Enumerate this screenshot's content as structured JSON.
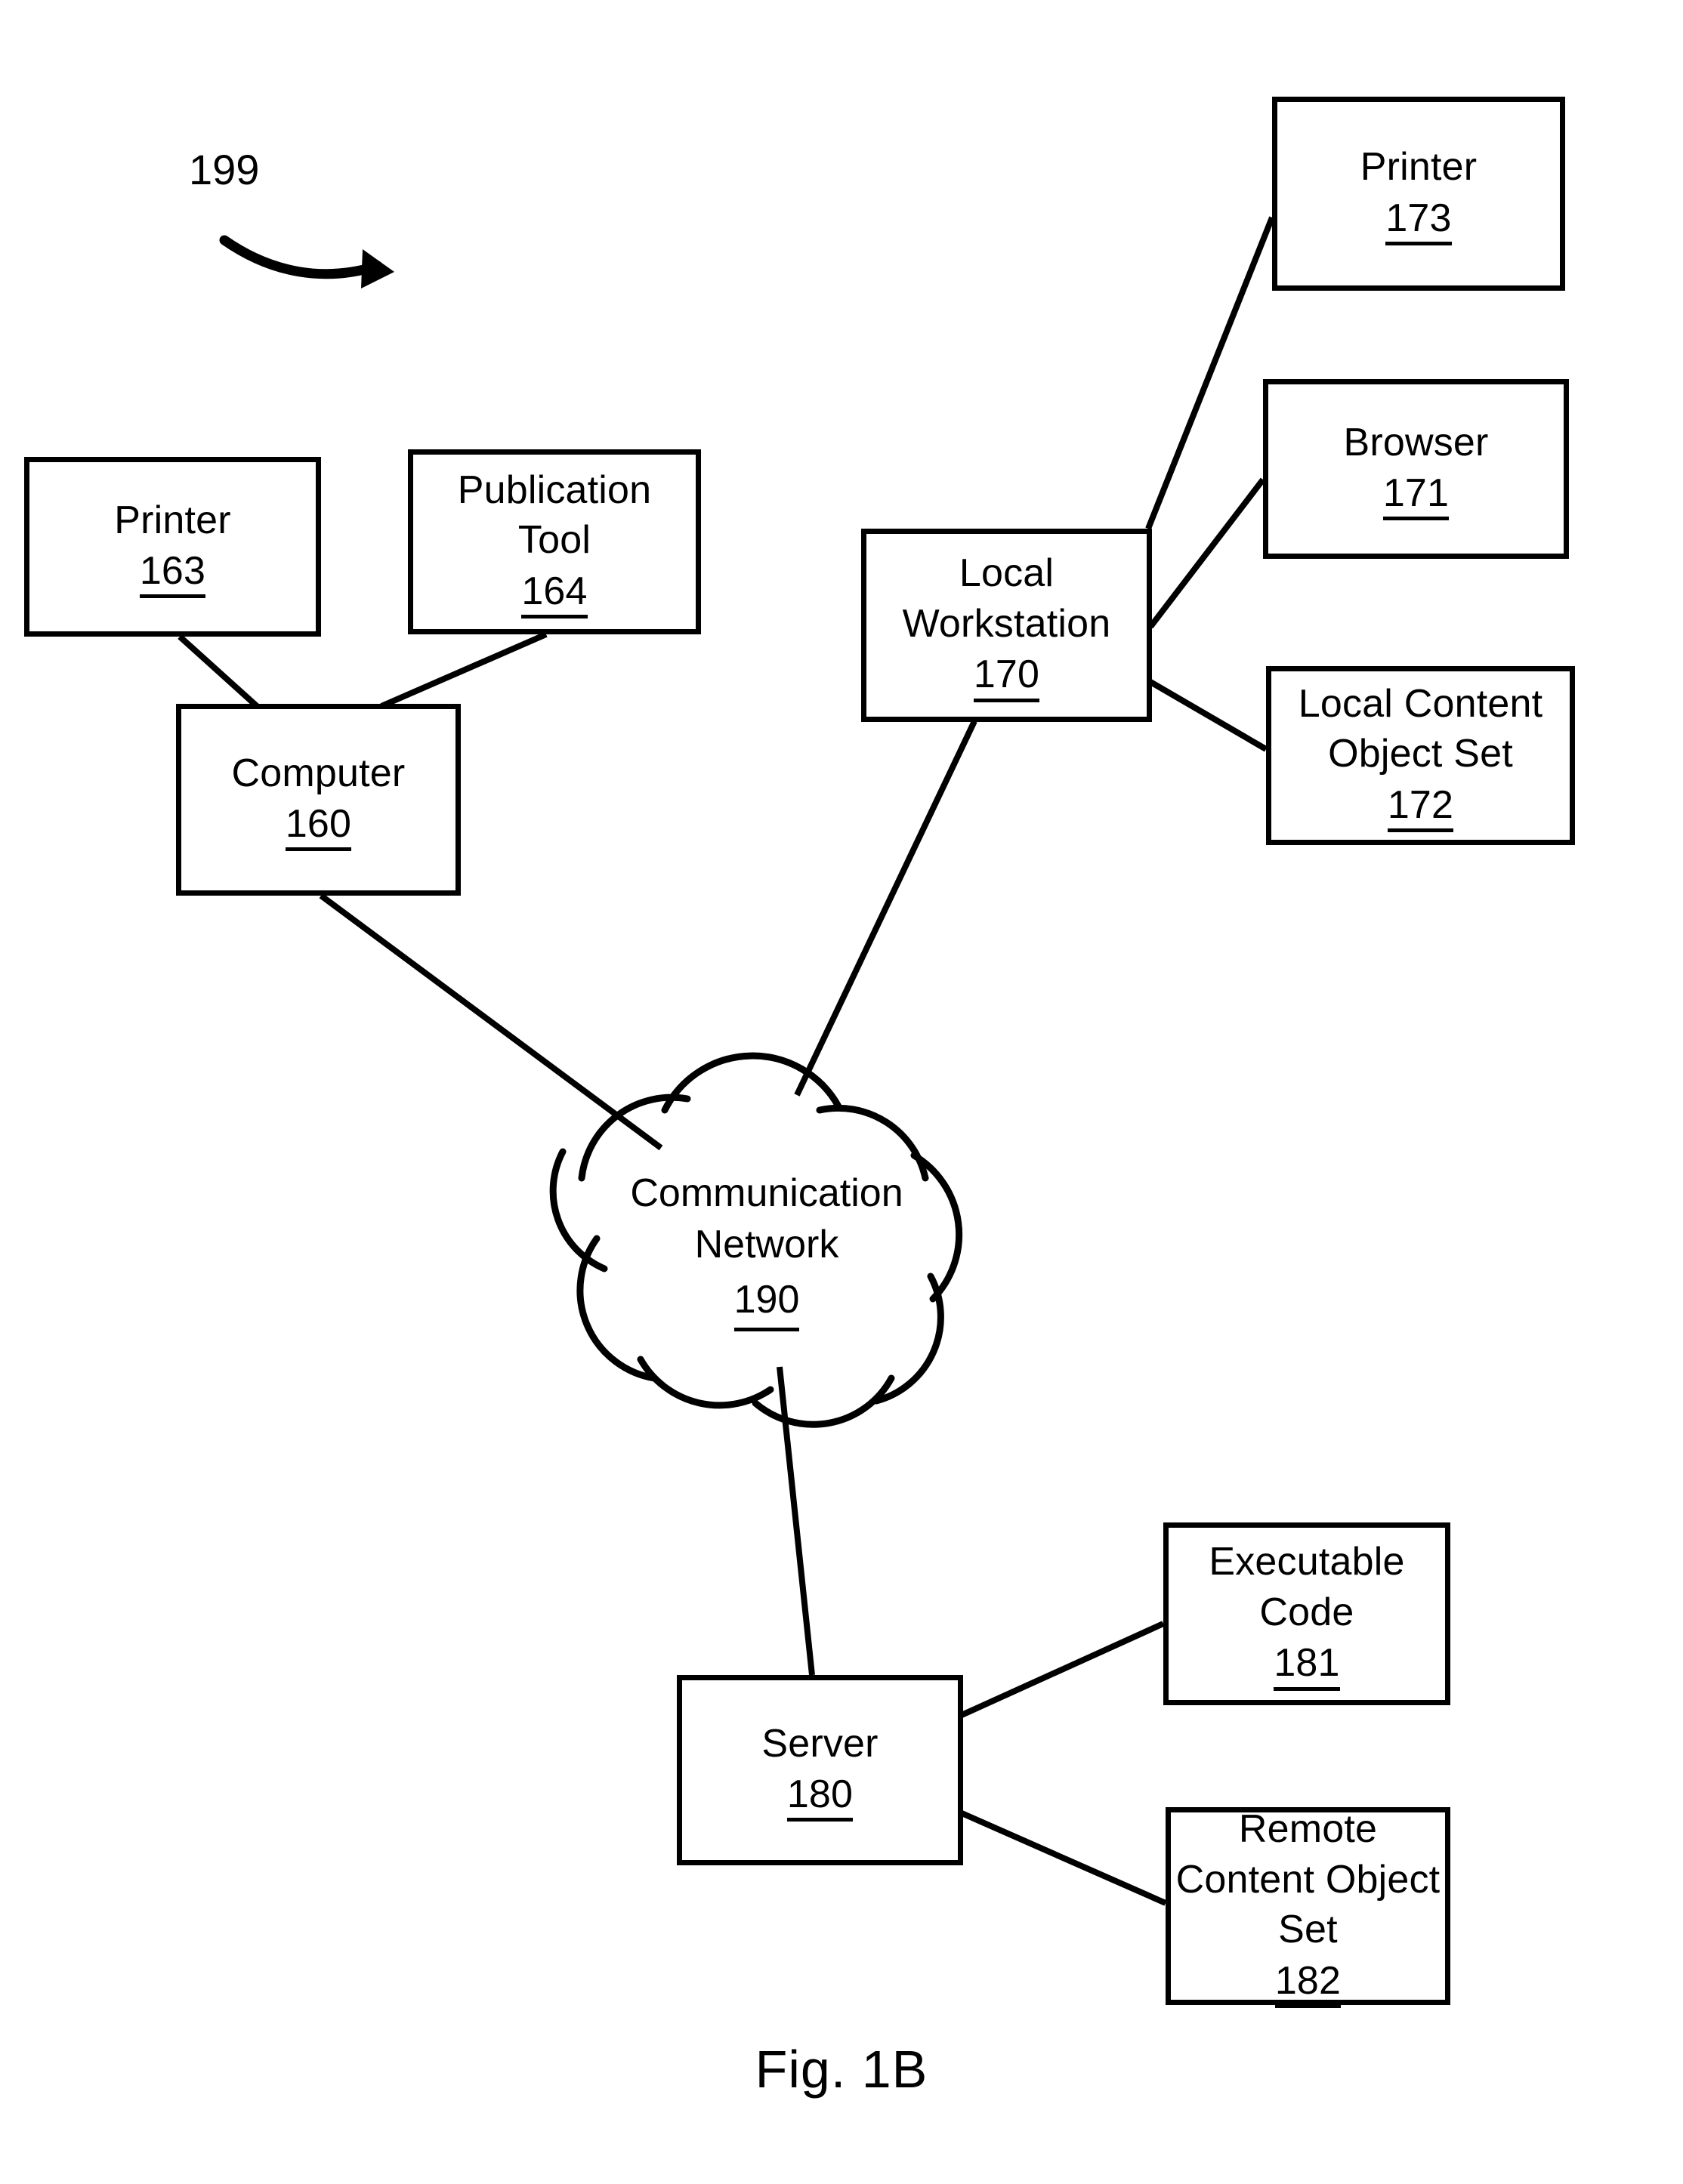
{
  "figure": {
    "caption": "Fig. 1B",
    "system_reference": "199"
  },
  "nodes": {
    "printer_173": {
      "label": "Printer",
      "ref": "173"
    },
    "browser_171": {
      "label": "Browser",
      "ref": "171"
    },
    "local_content_object_set_172": {
      "label": "Local Content\nObject Set",
      "ref": "172"
    },
    "local_workstation_170": {
      "label": "Local\nWorkstation",
      "ref": "170"
    },
    "printer_163": {
      "label": "Printer",
      "ref": "163"
    },
    "publication_tool_164": {
      "label": "Publication\nTool",
      "ref": "164"
    },
    "computer_160": {
      "label": "Computer",
      "ref": "160"
    },
    "communication_network_190": {
      "label": "Communication\nNetwork",
      "ref": "190"
    },
    "server_180": {
      "label": "Server",
      "ref": "180"
    },
    "executable_code_181": {
      "label": "Executable\nCode",
      "ref": "181"
    },
    "remote_content_object_set_182": {
      "label": "Remote\nContent Object\nSet",
      "ref": "182"
    }
  },
  "connections": [
    {
      "from": "printer_163",
      "to": "computer_160"
    },
    {
      "from": "publication_tool_164",
      "to": "computer_160"
    },
    {
      "from": "computer_160",
      "to": "communication_network_190"
    },
    {
      "from": "local_workstation_170",
      "to": "printer_173"
    },
    {
      "from": "local_workstation_170",
      "to": "browser_171"
    },
    {
      "from": "local_workstation_170",
      "to": "local_content_object_set_172"
    },
    {
      "from": "local_workstation_170",
      "to": "communication_network_190"
    },
    {
      "from": "communication_network_190",
      "to": "server_180"
    },
    {
      "from": "server_180",
      "to": "executable_code_181"
    },
    {
      "from": "server_180",
      "to": "remote_content_object_set_182"
    }
  ],
  "style": {
    "line_color": "#000000",
    "background_color": "#ffffff"
  }
}
